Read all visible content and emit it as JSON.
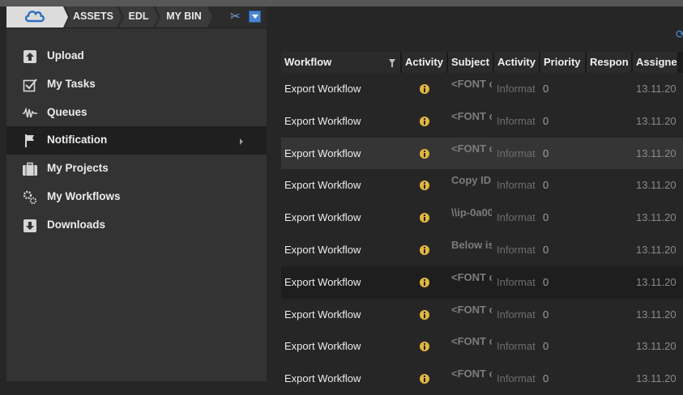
{
  "tabs": {
    "cloud_icon": "cloud-icon",
    "items": [
      "ASSETS",
      "EDL",
      "MY BIN"
    ]
  },
  "menu": {
    "items": [
      {
        "label": "Upload",
        "icon": "upload-icon"
      },
      {
        "label": "My Tasks",
        "icon": "check-icon"
      },
      {
        "label": "Queues",
        "icon": "waveform-icon"
      },
      {
        "label": "Notification",
        "icon": "flag-icon",
        "active": true
      },
      {
        "label": "My Projects",
        "icon": "briefcase-icon"
      },
      {
        "label": "My Workflows",
        "icon": "gears-icon"
      },
      {
        "label": "Downloads",
        "icon": "download-icon"
      }
    ]
  },
  "table": {
    "headers": [
      "Workflow",
      "Activity",
      "Subject",
      "Activity",
      "Priority",
      "Respon",
      "Assigne"
    ],
    "rows": [
      {
        "workflow": "Export Workflow",
        "subject": "<FONT c",
        "activity": "Informat",
        "priority": "0",
        "assigned": "13.11.20"
      },
      {
        "workflow": "Export Workflow",
        "subject": "<FONT c",
        "activity": "Informat",
        "priority": "0",
        "assigned": "13.11.20"
      },
      {
        "workflow": "Export Workflow",
        "subject": "<FONT c",
        "activity": "Informat",
        "priority": "0",
        "assigned": "13.11.20"
      },
      {
        "workflow": "Export Workflow",
        "subject": "Copy ID",
        "activity": "Informat",
        "priority": "0",
        "assigned": "13.11.20"
      },
      {
        "workflow": "Export Workflow",
        "subject": "\\\\ip-0a00",
        "activity": "Informat",
        "priority": "0",
        "assigned": "13.11.20"
      },
      {
        "workflow": "Export Workflow",
        "subject": "Below is",
        "activity": "Informat",
        "priority": "0",
        "assigned": "13.11.20"
      },
      {
        "workflow": "Export Workflow",
        "subject": "<FONT c",
        "activity": "Informat",
        "priority": "0",
        "assigned": "13.11.20"
      },
      {
        "workflow": "Export Workflow",
        "subject": "<FONT c",
        "activity": "Informat",
        "priority": "0",
        "assigned": "13.11.20"
      },
      {
        "workflow": "Export Workflow",
        "subject": "<FONT c",
        "activity": "Informat",
        "priority": "0",
        "assigned": "13.11.20"
      },
      {
        "workflow": "Export Workflow",
        "subject": "<FONT c",
        "activity": "Informat",
        "priority": "0",
        "assigned": "13.11.20"
      }
    ]
  },
  "colors": {
    "accent": "#4a86d0",
    "activity_icon": "#e2b640"
  }
}
